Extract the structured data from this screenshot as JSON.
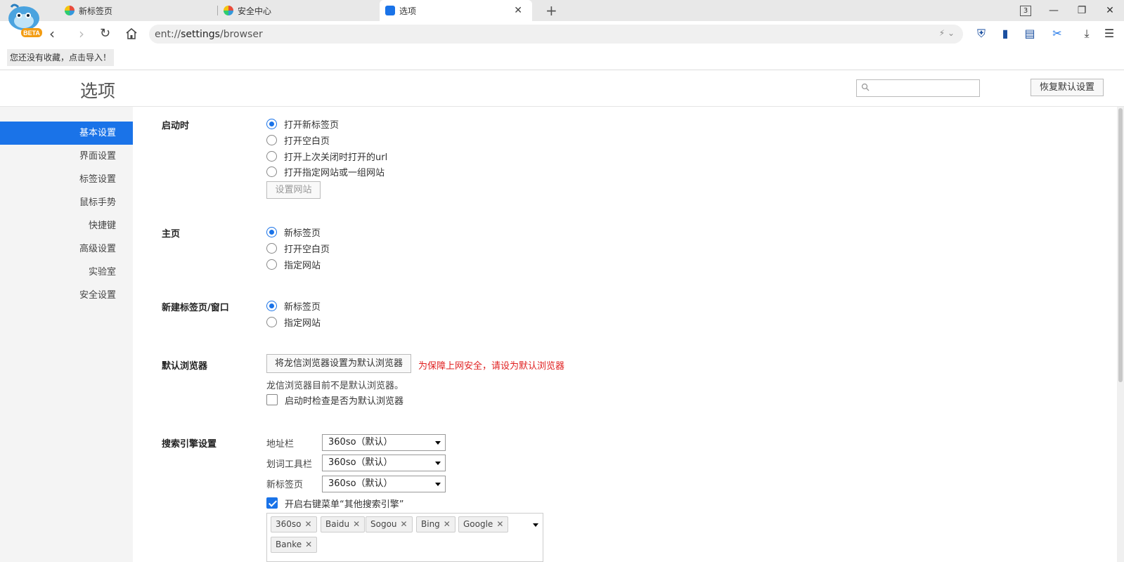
{
  "tabs": [
    {
      "title": "新标签页",
      "active": false
    },
    {
      "title": "安全中心",
      "active": false
    },
    {
      "title": "选项",
      "active": true
    }
  ],
  "window": {
    "tab_count": "3",
    "logo_badge": "BETA"
  },
  "address_bar": {
    "scheme": "ent://",
    "host": "settings",
    "path": "/browser"
  },
  "bookmarks": {
    "empty_hint": "您还没有收藏，点击导入！"
  },
  "header": {
    "title": "选项",
    "search_placeholder": "",
    "restore_label": "恢复默认设置"
  },
  "sidebar": {
    "items": [
      {
        "label": "基本设置",
        "active": true
      },
      {
        "label": "界面设置",
        "active": false
      },
      {
        "label": "标签设置",
        "active": false
      },
      {
        "label": "鼠标手势",
        "active": false
      },
      {
        "label": "快捷键",
        "active": false
      },
      {
        "label": "高级设置",
        "active": false
      },
      {
        "label": "实验室",
        "active": false
      },
      {
        "label": "安全设置",
        "active": false
      }
    ]
  },
  "startup": {
    "label": "启动时",
    "options": [
      "打开新标签页",
      "打开空白页",
      "打开上次关闭时打开的url",
      "打开指定网站或一组网站"
    ],
    "selected": 0,
    "set_sites_button": "设置网站"
  },
  "homepage": {
    "label": "主页",
    "options": [
      "新标签页",
      "打开空白页",
      "指定网站"
    ],
    "selected": 0
  },
  "new_tab": {
    "label": "新建标签页/窗口",
    "options": [
      "新标签页",
      "指定网站"
    ],
    "selected": 0
  },
  "default_browser": {
    "label": "默认浏览器",
    "button": "将龙信浏览器设置为默认浏览器",
    "warning": "为保障上网安全，请设为默认浏览器",
    "status": "龙信浏览器目前不是默认浏览器。",
    "check_label": "启动时检查是否为默认浏览器",
    "check_on": false
  },
  "search_engine": {
    "label": "搜索引擎设置",
    "rows": [
      {
        "label": "地址栏",
        "value": "360so（默认）"
      },
      {
        "label": "划词工具栏",
        "value": "360so（默认）"
      },
      {
        "label": "新标签页",
        "value": "360so（默认）"
      }
    ],
    "context_menu_label": "开启右键菜单“其他搜索引擎”",
    "context_menu_on": true,
    "engines": [
      "360so",
      "Baidu",
      "Sogou",
      "Bing",
      "Google",
      "Banke"
    ]
  },
  "colors": {
    "accent": "#1a73e8",
    "warning": "#e02020"
  }
}
